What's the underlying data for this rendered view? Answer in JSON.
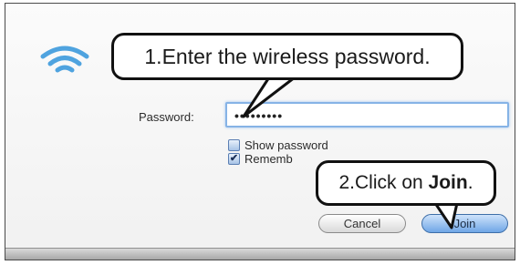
{
  "callouts": {
    "step1": "1.Enter the wireless password.",
    "step2_prefix": "2.Click on ",
    "step2_emphasis": "Join",
    "step2_suffix": "."
  },
  "form": {
    "password_label": "Password:",
    "password_value": "•••••••••",
    "show_password_label": "Show password",
    "show_password_checked": false,
    "remember_label": "Rememb",
    "remember_checked": true
  },
  "buttons": {
    "cancel": "Cancel",
    "join": "Join"
  },
  "icons": {
    "wifi": "wifi-icon",
    "checkmark": "checkmark-icon"
  },
  "colors": {
    "focus_ring": "#86b3e6",
    "join_button": "#6fa6e6",
    "wifi_icon": "#4fa3df"
  }
}
